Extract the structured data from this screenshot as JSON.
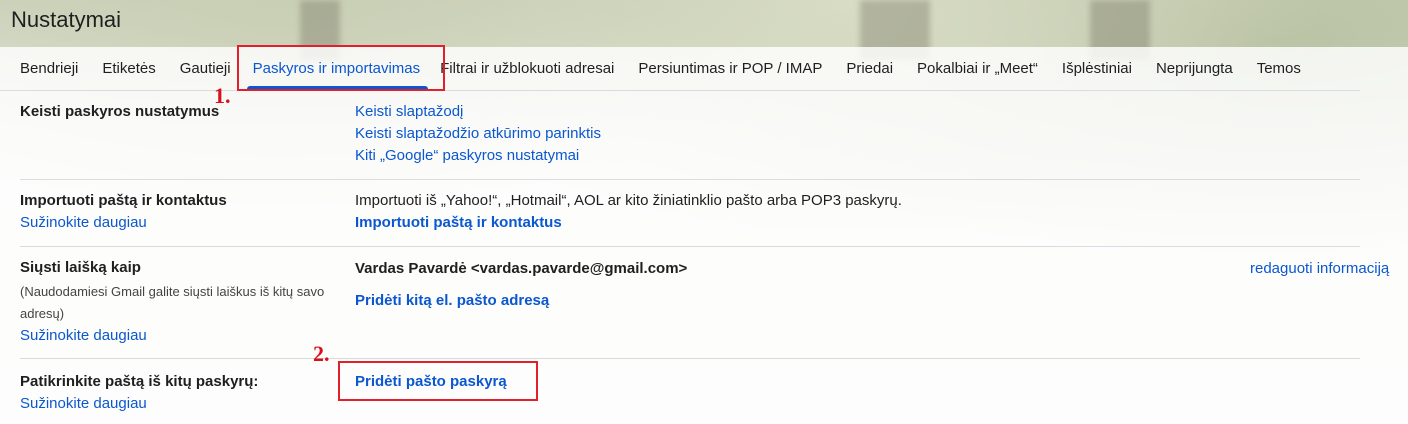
{
  "page_title": "Nustatymai",
  "tabs": [
    {
      "label": "Bendrieji"
    },
    {
      "label": "Etiketės"
    },
    {
      "label": "Gautieji"
    },
    {
      "label": "Paskyros ir importavimas"
    },
    {
      "label": "Filtrai ir užblokuoti adresai"
    },
    {
      "label": "Persiuntimas ir POP / IMAP"
    },
    {
      "label": "Priedai"
    },
    {
      "label": "Pokalbiai ir „Meet“"
    },
    {
      "label": "Išplėstiniai"
    },
    {
      "label": "Neprijungta"
    },
    {
      "label": "Temos"
    }
  ],
  "active_tab": "Paskyros ir importavimas",
  "markers": {
    "one": "1.",
    "two": "2."
  },
  "sections": {
    "change_account": {
      "label": "Keisti paskyros nustatymus",
      "links": [
        "Keisti slaptažodį",
        "Keisti slaptažodžio atkūrimo parinktis",
        "Kiti „Google“ paskyros nustatymai"
      ]
    },
    "import": {
      "label": "Importuoti paštą ir kontaktus",
      "learn_more": "Sužinokite daugiau",
      "description": "Importuoti iš „Yahoo!“, „Hotmail“, AOL ar kito žiniatinklio pašto arba POP3 paskyrų.",
      "action": "Importuoti paštą ir kontaktus"
    },
    "send_as": {
      "label": "Siųsti laišką kaip",
      "note_line1": "(Naudodamiesi Gmail galite siųsti laiškus iš kitų savo",
      "note_line2": "adresų)",
      "learn_more": "Sužinokite daugiau",
      "address": "Vardas Pavardė <vardas.pavarde@gmail.com>",
      "edit": "redaguoti informaciją",
      "add": "Pridėti kitą el. pašto adresą"
    },
    "check_mail": {
      "label": "Patikrinkite paštą iš kitų paskyrų:",
      "learn_more": "Sužinokite daugiau",
      "add": "Pridėti pašto paskyrą"
    }
  },
  "colors": {
    "accent": "#0b57d0",
    "highlight": "#e0202a"
  }
}
